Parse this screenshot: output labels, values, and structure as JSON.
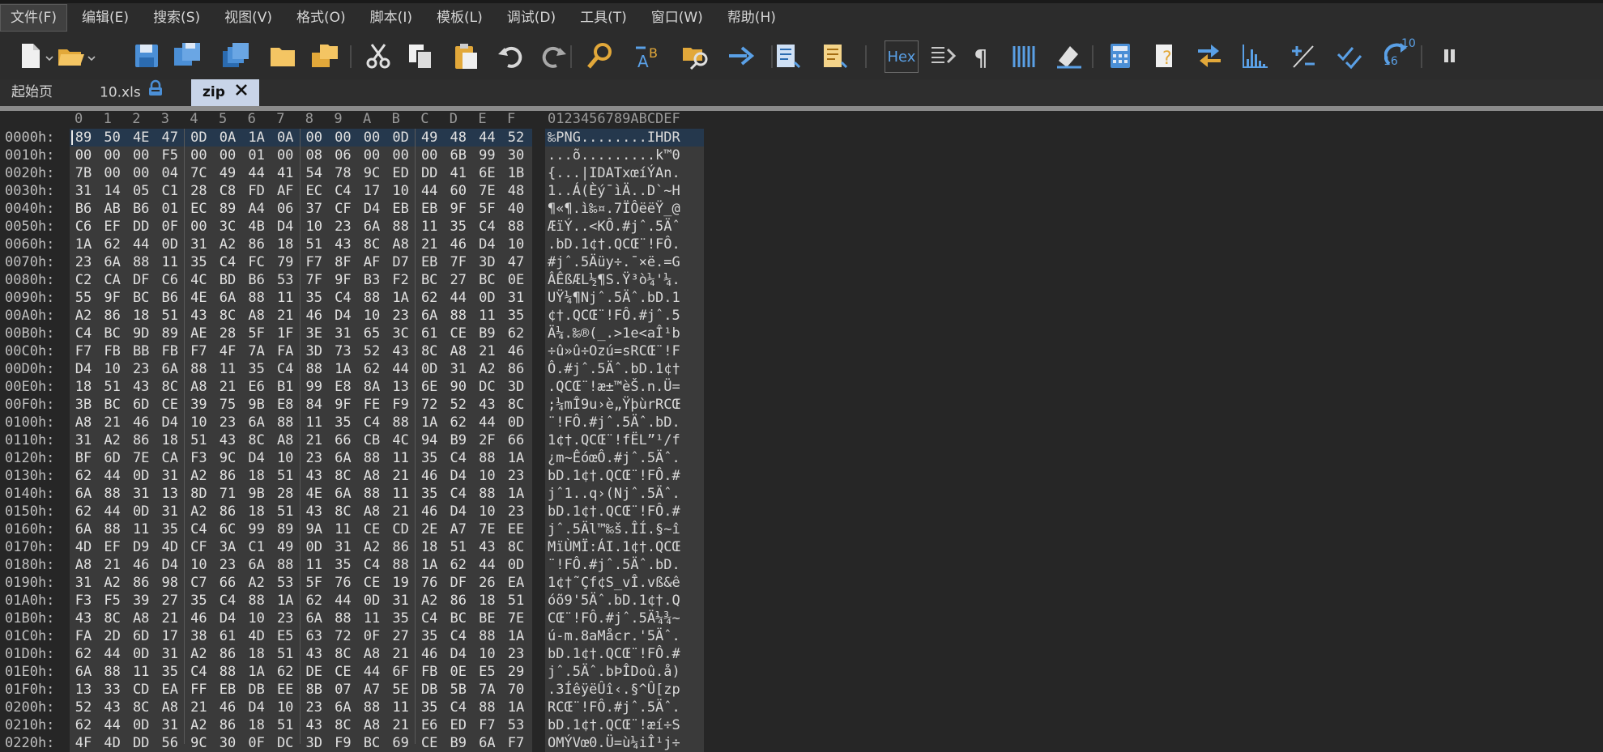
{
  "menu": [
    "文件(F)",
    "编辑(E)",
    "搜索(S)",
    "视图(V)",
    "格式(O)",
    "脚本(I)",
    "模板(L)",
    "调试(D)",
    "工具(T)",
    "窗口(W)",
    "帮助(H)"
  ],
  "toolbar": {
    "icons": [
      "new-file-icon",
      "open-folder-icon",
      "save-icon",
      "save-as-icon",
      "save-all-icon",
      "folder-icon",
      "open-multiple-icon",
      "cut-icon",
      "copy-icon",
      "paste-icon",
      "undo-icon",
      "redo-icon",
      "find-icon",
      "replace-icon",
      "find-in-files-icon",
      "goto-icon",
      "template-icon",
      "script-icon",
      "hex-mode-icon",
      "text-mode-icon",
      "pilcrow-icon",
      "columns-icon",
      "highlight-icon",
      "calculator-icon",
      "inspector-icon",
      "compare-icon",
      "histogram-icon",
      "math-operation-icon",
      "checksum-icon",
      "base-convert-icon",
      "pause-icon"
    ],
    "hex_label": "Hex",
    "base_top": "10",
    "base_bottom": "16"
  },
  "tabs": [
    {
      "label": "起始页"
    },
    {
      "label": "10.xls",
      "locked": true
    },
    {
      "label": "zip",
      "active": true
    }
  ],
  "hex_columns": [
    "0",
    "1",
    "2",
    "3",
    "4",
    "5",
    "6",
    "7",
    "8",
    "9",
    "A",
    "B",
    "C",
    "D",
    "E",
    "F"
  ],
  "ascii_header": "0123456789ABCDEF",
  "rows": [
    {
      "addr": "0000h:",
      "hex": "89 50 4E 47 0D 0A 1A 0A 00 00 00 0D 49 48 44 52",
      "ascii": "‰PNG........IHDR"
    },
    {
      "addr": "0010h:",
      "hex": "00 00 00 F5 00 00 01 00 08 06 00 00 00 6B 99 30",
      "ascii": "...õ.........k™0"
    },
    {
      "addr": "0020h:",
      "hex": "7B 00 00 04 7C 49 44 41 54 78 9C ED DD 41 6E 1B",
      "ascii": "{...|IDATxœíÝAn."
    },
    {
      "addr": "0030h:",
      "hex": "31 14 05 C1 28 C8 FD AF EC C4 17 10 44 60 7E 48",
      "ascii": "1..Á(Èý¯ìÄ..D`~H"
    },
    {
      "addr": "0040h:",
      "hex": "B6 AB B6 01 EC 89 A4 06 37 CF D4 EB EB 9F 5F 40",
      "ascii": "¶«¶.ì‰¤.7ÏÔëëŸ_@"
    },
    {
      "addr": "0050h:",
      "hex": "C6 EF DD 0F 00 3C 4B D4 10 23 6A 88 11 35 C4 88",
      "ascii": "ÆïÝ..<KÔ.#jˆ.5Äˆ"
    },
    {
      "addr": "0060h:",
      "hex": "1A 62 44 0D 31 A2 86 18 51 43 8C A8 21 46 D4 10",
      "ascii": ".bD.1¢†.QCŒ¨!FÔ."
    },
    {
      "addr": "0070h:",
      "hex": "23 6A 88 11 35 C4 FC 79 F7 8F AF D7 EB 7F 3D 47",
      "ascii": "#jˆ.5Äüy÷.¯×ë.=G"
    },
    {
      "addr": "0080h:",
      "hex": "C2 CA DF C6 4C BD B6 53 7F 9F B3 F2 BC 27 BC 0E",
      "ascii": "ÂÊßÆL½¶S.Ÿ³ò¼'¼."
    },
    {
      "addr": "0090h:",
      "hex": "55 9F BC B6 4E 6A 88 11 35 C4 88 1A 62 44 0D 31",
      "ascii": "UŸ¼¶Njˆ.5Äˆ.bD.1"
    },
    {
      "addr": "00A0h:",
      "hex": "A2 86 18 51 43 8C A8 21 46 D4 10 23 6A 88 11 35",
      "ascii": "¢†.QCŒ¨!FÔ.#jˆ.5"
    },
    {
      "addr": "00B0h:",
      "hex": "C4 BC 9D 89 AE 28 5F 1F 3E 31 65 3C 61 CE B9 62",
      "ascii": "Ä¼.‰®(_.>1e<aÎ¹b"
    },
    {
      "addr": "00C0h:",
      "hex": "F7 FB BB FB F7 4F 7A FA 3D 73 52 43 8C A8 21 46",
      "ascii": "÷û»û÷Ozú=sRCŒ¨!F"
    },
    {
      "addr": "00D0h:",
      "hex": "D4 10 23 6A 88 11 35 C4 88 1A 62 44 0D 31 A2 86",
      "ascii": "Ô.#jˆ.5Äˆ.bD.1¢†"
    },
    {
      "addr": "00E0h:",
      "hex": "18 51 43 8C A8 21 E6 B1 99 E8 8A 13 6E 90 DC 3D",
      "ascii": ".QCŒ¨!æ±™èŠ.n.Ü="
    },
    {
      "addr": "00F0h:",
      "hex": "3B BC 6D CE 39 75 9B E8 84 9F FE F9 72 52 43 8C",
      "ascii": ";¼mÎ9u›è„ŸþùrRCŒ"
    },
    {
      "addr": "0100h:",
      "hex": "A8 21 46 D4 10 23 6A 88 11 35 C4 88 1A 62 44 0D",
      "ascii": "¨!FÔ.#jˆ.5Äˆ.bD."
    },
    {
      "addr": "0110h:",
      "hex": "31 A2 86 18 51 43 8C A8 21 66 CB 4C 94 B9 2F 66",
      "ascii": "1¢†.QCŒ¨!fËL”¹/f"
    },
    {
      "addr": "0120h:",
      "hex": "BF 6D 7E CA F3 9C D4 10 23 6A 88 11 35 C4 88 1A",
      "ascii": "¿m~ÊóœÔ.#jˆ.5Äˆ."
    },
    {
      "addr": "0130h:",
      "hex": "62 44 0D 31 A2 86 18 51 43 8C A8 21 46 D4 10 23",
      "ascii": "bD.1¢†.QCŒ¨!FÔ.#"
    },
    {
      "addr": "0140h:",
      "hex": "6A 88 31 13 8D 71 9B 28 4E 6A 88 11 35 C4 88 1A",
      "ascii": "jˆ1..q›(Njˆ.5Äˆ."
    },
    {
      "addr": "0150h:",
      "hex": "62 44 0D 31 A2 86 18 51 43 8C A8 21 46 D4 10 23",
      "ascii": "bD.1¢†.QCŒ¨!FÔ.#"
    },
    {
      "addr": "0160h:",
      "hex": "6A 88 11 35 C4 6C 99 89 9A 11 CE CD 2E A7 7E EE",
      "ascii": "jˆ.5Äl™‰š.ÎÍ.§~î"
    },
    {
      "addr": "0170h:",
      "hex": "4D EF D9 4D CF 3A C1 49 0D 31 A2 86 18 51 43 8C",
      "ascii": "MïÙMÏ:ÁI.1¢†.QCŒ"
    },
    {
      "addr": "0180h:",
      "hex": "A8 21 46 D4 10 23 6A 88 11 35 C4 88 1A 62 44 0D",
      "ascii": "¨!FÔ.#jˆ.5Äˆ.bD."
    },
    {
      "addr": "0190h:",
      "hex": "31 A2 86 98 C7 66 A2 53 5F 76 CE 19 76 DF 26 EA",
      "ascii": "1¢†˜Çf¢S_vÎ.vß&ê"
    },
    {
      "addr": "01A0h:",
      "hex": "F3 F5 39 27 35 C4 88 1A 62 44 0D 31 A2 86 18 51",
      "ascii": "óõ9'5Äˆ.bD.1¢†.Q"
    },
    {
      "addr": "01B0h:",
      "hex": "43 8C A8 21 46 D4 10 23 6A 88 11 35 C4 BC BE 7E",
      "ascii": "CŒ¨!FÔ.#jˆ.5Ä¼¾~"
    },
    {
      "addr": "01C0h:",
      "hex": "FA 2D 6D 17 38 61 4D E5 63 72 0F 27 35 C4 88 1A",
      "ascii": "ú-m.8aMåcr.'5Äˆ."
    },
    {
      "addr": "01D0h:",
      "hex": "62 44 0D 31 A2 86 18 51 43 8C A8 21 46 D4 10 23",
      "ascii": "bD.1¢†.QCŒ¨!FÔ.#"
    },
    {
      "addr": "01E0h:",
      "hex": "6A 88 11 35 C4 88 1A 62 DE CE 44 6F FB 0E E5 29",
      "ascii": "jˆ.5Äˆ.bÞÎDoû.å)"
    },
    {
      "addr": "01F0h:",
      "hex": "13 33 CD EA FF EB DB EE 8B 07 A7 5E DB 5B 7A 70",
      "ascii": ".3ÍêÿëÛî‹.§^Û[zp"
    },
    {
      "addr": "0200h:",
      "hex": "52 43 8C A8 21 46 D4 10 23 6A 88 11 35 C4 88 1A",
      "ascii": "RCŒ¨!FÔ.#jˆ.5Äˆ."
    },
    {
      "addr": "0210h:",
      "hex": "62 44 0D 31 A2 86 18 51 43 8C A8 21 E6 ED F7 53",
      "ascii": "bD.1¢†.QCŒ¨!æí÷S"
    },
    {
      "addr": "0220h:",
      "hex": "4F 4D DD 56 9C 30 0F DC 3D F9 BC 69 CE B9 6A F7",
      "ascii": "OMÝVœ0.Ü=ù¼iÎ¹j÷"
    }
  ],
  "colors": {
    "background": "#262626",
    "selection": "#25384d",
    "cell_bg": "#3a3a3a"
  }
}
